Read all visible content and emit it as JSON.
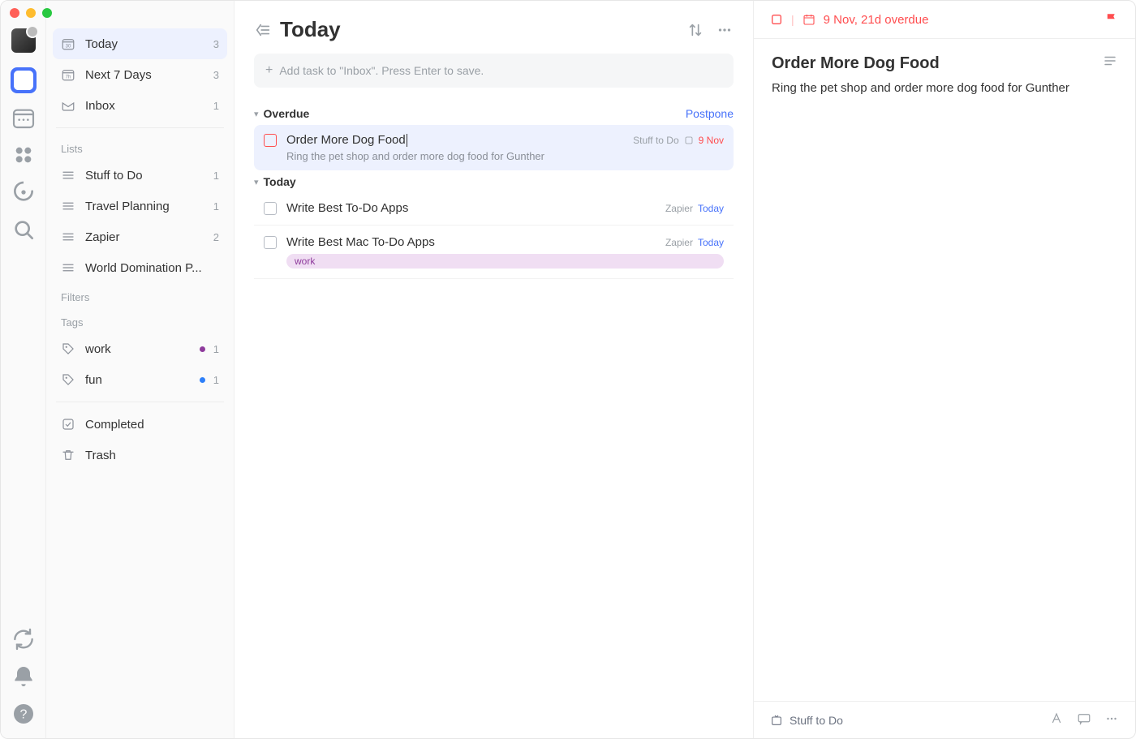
{
  "rail": {
    "icons": [
      "check",
      "calendar",
      "matrix",
      "clock",
      "search"
    ],
    "bottom": [
      "sync",
      "bell",
      "help"
    ]
  },
  "sidebar": {
    "smart": [
      {
        "icon": "today",
        "label": "Today",
        "count": "3",
        "active": true
      },
      {
        "icon": "week",
        "label": "Next 7 Days",
        "count": "3"
      },
      {
        "icon": "inbox",
        "label": "Inbox",
        "count": "1"
      }
    ],
    "lists_header": "Lists",
    "lists": [
      {
        "label": "Stuff to Do",
        "count": "1"
      },
      {
        "label": "Travel Planning",
        "count": "1"
      },
      {
        "label": "Zapier",
        "count": "2"
      },
      {
        "label": "World Domination P..."
      }
    ],
    "filters_header": "Filters",
    "tags_header": "Tags",
    "tags": [
      {
        "label": "work",
        "color": "purple",
        "count": "1"
      },
      {
        "label": "fun",
        "color": "blue",
        "count": "1"
      }
    ],
    "completed": "Completed",
    "trash": "Trash"
  },
  "main": {
    "title": "Today",
    "add_placeholder": "Add task to \"Inbox\". Press Enter to save.",
    "sections": {
      "overdue": {
        "label": "Overdue",
        "action": "Postpone",
        "tasks": [
          {
            "title": "Order More Dog Food",
            "desc": "Ring the pet shop and order more dog food for Gunther",
            "list": "Stuff to Do",
            "date": "9 Nov",
            "overdue": true,
            "selected": true,
            "editing": true
          }
        ]
      },
      "today": {
        "label": "Today",
        "tasks": [
          {
            "title": "Write Best To-Do Apps",
            "list": "Zapier",
            "date": "Today"
          },
          {
            "title": "Write Best Mac To-Do Apps",
            "list": "Zapier",
            "date": "Today",
            "tags": [
              "work"
            ]
          }
        ]
      }
    }
  },
  "detail": {
    "due": "9 Nov, 21d overdue",
    "title": "Order More Dog Food",
    "body": "Ring the pet shop and order more dog food for Gunther",
    "footer_list": "Stuff to Do"
  }
}
